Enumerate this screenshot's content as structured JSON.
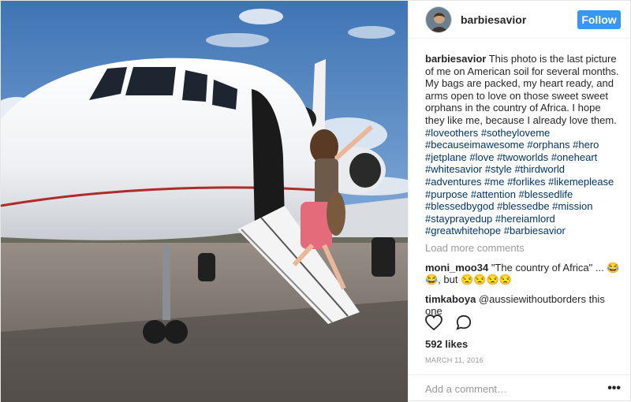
{
  "header": {
    "username": "barbiesavior",
    "follow_label": "Follow"
  },
  "caption": {
    "username": "barbiesavior",
    "text": "This photo is the last picture of me on American soil for several months. My bags are packed, my heart ready, and arms open to love on those sweet sweet orphans in the country of Africa. I hope they like me, because I already love them.",
    "hashtags": "#loveothers #sotheyloveme #becauseimawesome #orphans #hero #jetplane #love #twoworlds #oneheart #whitesavior #style #thirdworld #adventures #me #forlikes #likemeplease #purpose #attention #blessedlife #blessedbygod #blessedbe #mission #stayprayedup #hereiamlord #greatwhitehope #barbiesavior"
  },
  "load_more_label": "Load more comments",
  "comments": [
    {
      "username": "moni_moo34",
      "text": "\"The country of Africa\" ... 😂😂, but 😒😒😒😒"
    },
    {
      "username": "timkaboya",
      "text": "@aussiewithoutborders this one"
    }
  ],
  "likes": "592 likes",
  "date": "MARCH 11, 2016",
  "add_comment_placeholder": "Add a comment…",
  "more_label": "•••",
  "icons": [
    "heart-icon",
    "comment-icon",
    "more-options-icon"
  ],
  "colors": {
    "follow": "#3897f0",
    "hashtag": "#003569",
    "muted": "#999999"
  }
}
